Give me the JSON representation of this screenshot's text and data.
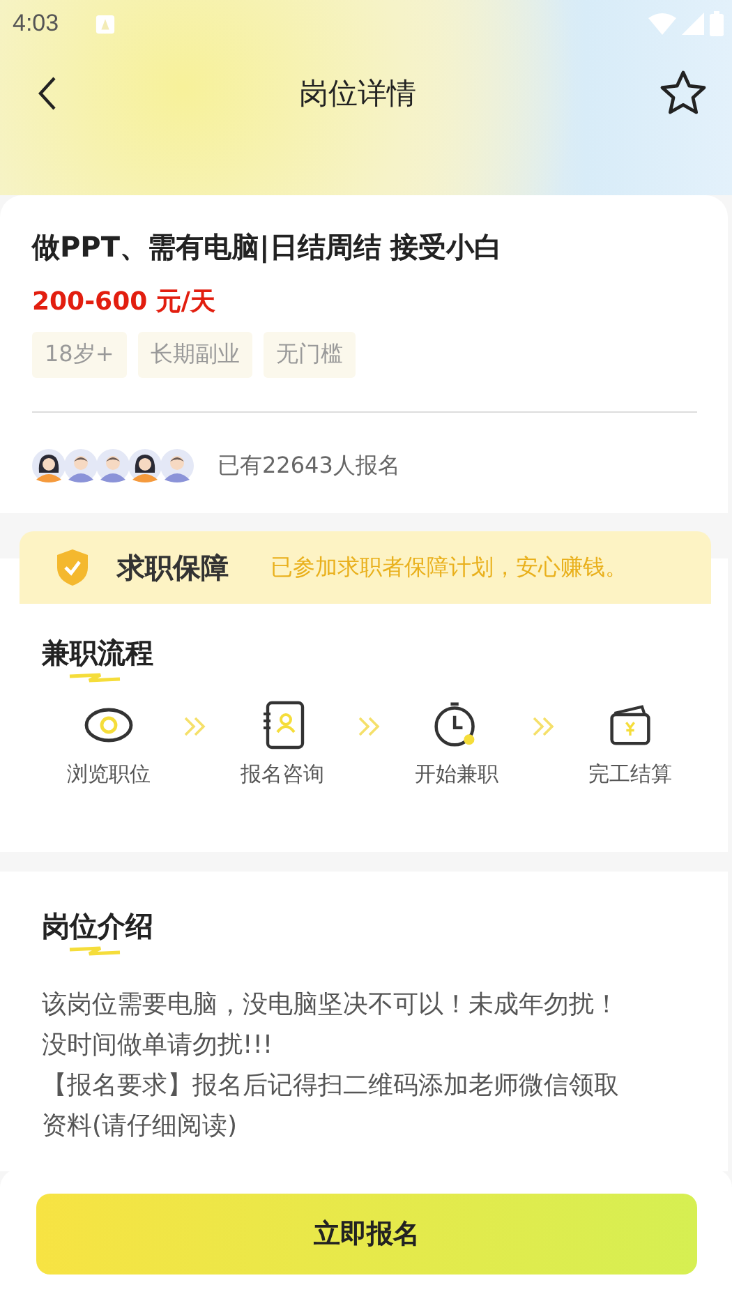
{
  "status_bar": {
    "time": "4:03"
  },
  "header": {
    "title": "岗位详情",
    "favorited": false
  },
  "job": {
    "title": "做PPT、需有电脑|日结周结 接受小白",
    "salary": "200-600 元/天",
    "tags": [
      "18岁+",
      "长期副业",
      "无门槛"
    ],
    "avatars": [
      {
        "kind": "female"
      },
      {
        "kind": "male"
      },
      {
        "kind": "male"
      },
      {
        "kind": "female"
      },
      {
        "kind": "male"
      }
    ],
    "applicants": "已有22643人报名"
  },
  "guarantee": {
    "title": "求职保障",
    "text": "已参加求职者保障计划，安心赚钱。"
  },
  "process": {
    "title": "兼职流程",
    "steps": [
      {
        "kind": "eye",
        "label": "浏览职位"
      },
      {
        "kind": "contact",
        "label": "报名咨询"
      },
      {
        "kind": "clock",
        "label": "开始兼职"
      },
      {
        "kind": "wallet",
        "label": "完工结算"
      }
    ]
  },
  "intro": {
    "title": "岗位介绍",
    "lines": [
      "该岗位需要电脑，没电脑坚决不可以！未成年勿扰！",
      "没时间做单请勿扰!!!",
      "【报名要求】报名后记得扫二维码添加老师微信领取",
      "资料(请仔细阅读)"
    ]
  },
  "apply_button": "立即报名"
}
